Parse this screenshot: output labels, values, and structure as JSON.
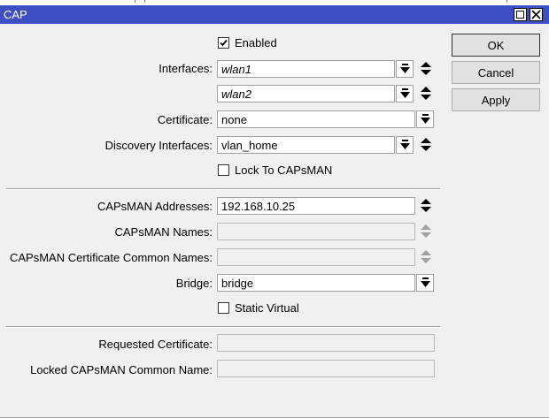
{
  "window": {
    "title": "CAP"
  },
  "form": {
    "enabled": {
      "label": "Enabled",
      "checked": true
    },
    "interfaces": {
      "label": "Interfaces:",
      "values": [
        "wlan1",
        "wlan2"
      ]
    },
    "certificate": {
      "label": "Certificate:",
      "value": "none"
    },
    "discovery_interfaces": {
      "label": "Discovery Interfaces:",
      "value": "vlan_home"
    },
    "lock_to_capsman": {
      "label": "Lock To CAPsMAN",
      "checked": false
    },
    "capsman_addresses": {
      "label": "CAPsMAN Addresses:",
      "value": "192.168.10.25"
    },
    "capsman_names": {
      "label": "CAPsMAN Names:",
      "value": ""
    },
    "capsman_cert_common_names": {
      "label": "CAPsMAN Certificate Common Names:",
      "value": ""
    },
    "bridge": {
      "label": "Bridge:",
      "value": "bridge"
    },
    "static_virtual": {
      "label": "Static Virtual",
      "checked": false
    },
    "requested_certificate": {
      "label": "Requested Certificate:",
      "value": ""
    },
    "locked_capsman_common_name": {
      "label": "Locked CAPsMAN Common Name:",
      "value": ""
    }
  },
  "buttons": {
    "ok": "OK",
    "cancel": "Cancel",
    "apply": "Apply"
  },
  "icons": {
    "dropdown": "dropdown-arrow-icon",
    "updown": "up-down-arrows-icon",
    "check": "checkmark-icon",
    "maximize": "maximize-icon",
    "close": "close-icon"
  }
}
